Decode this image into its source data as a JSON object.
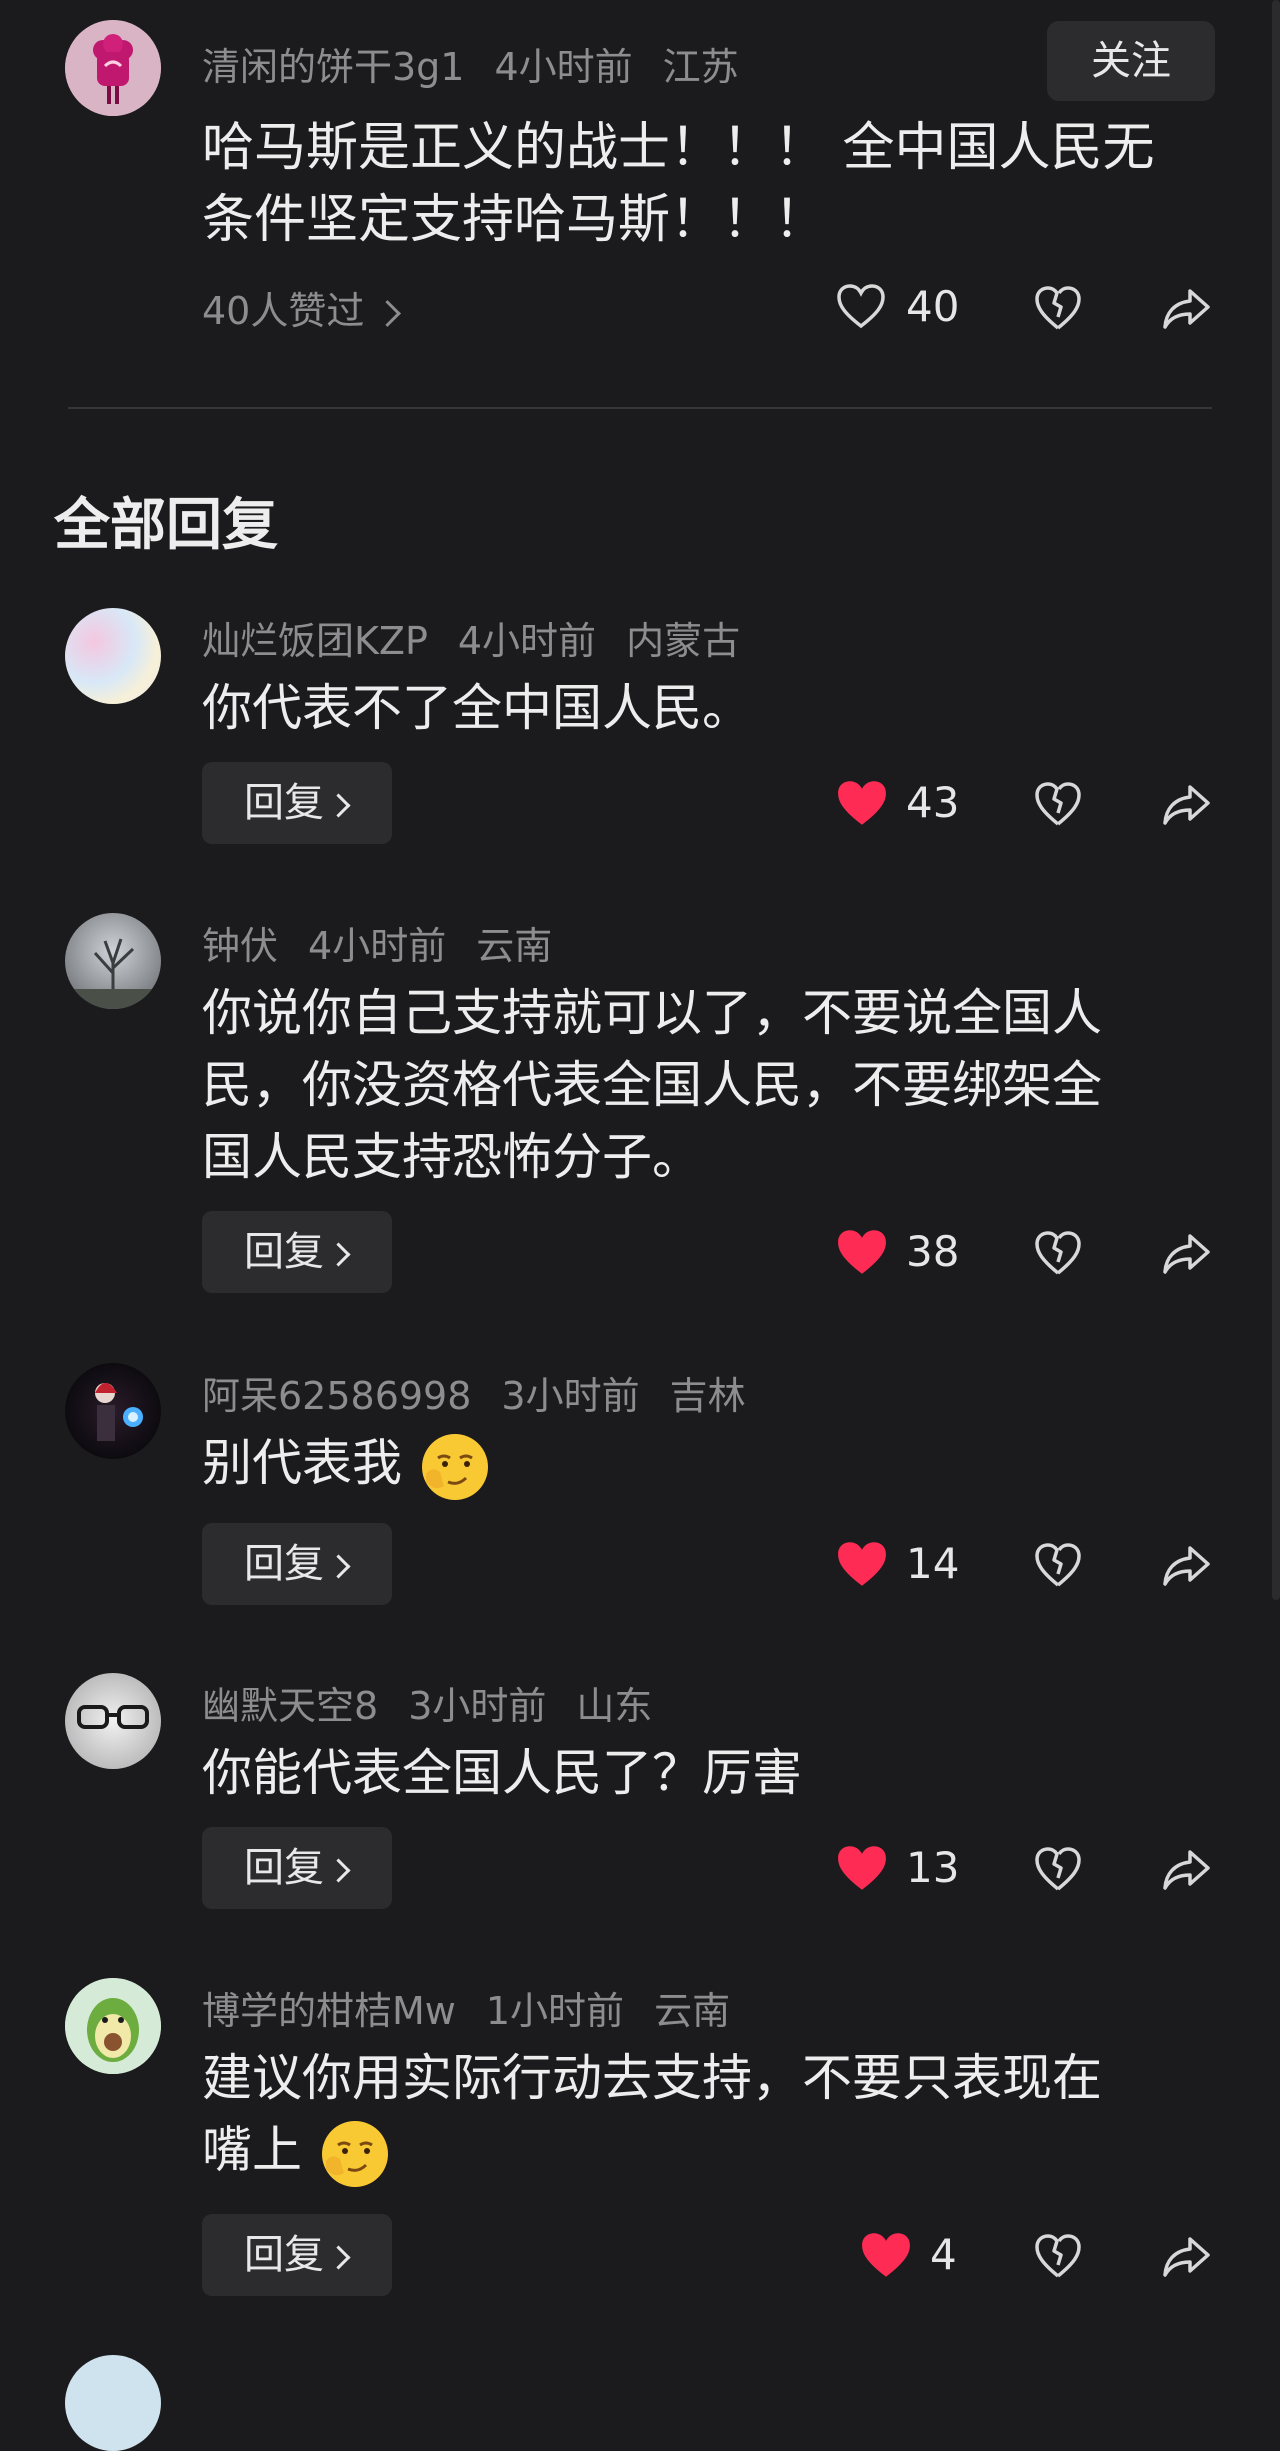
{
  "top_post": {
    "username": "清闲的饼干3g1",
    "time": "4小时前",
    "location": "江苏",
    "follow_label": "关注",
    "content_lines": [
      "哈马斯是正义的战士！！！ 全中国人民无",
      "条件坚定支持哈马斯！！！"
    ],
    "likes_link": "40人赞过",
    "like_count": "40",
    "like_icon": "heart-outline-icon",
    "dislike_icon": "broken-heart-icon",
    "share_icon": "share-icon"
  },
  "section_title": "全部回复",
  "reply_label": "回复",
  "comments": [
    {
      "username": "灿烂饭团KZP",
      "time": "4小时前",
      "location": "内蒙古",
      "lines": [
        "你代表不了全中国人民。"
      ],
      "likes": "43",
      "emoji": ""
    },
    {
      "username": "钟伏",
      "time": "4小时前",
      "location": "云南",
      "lines": [
        "你说你自己支持就可以了，不要说全国人",
        "民，你没资格代表全国人民，不要绑架全",
        "国人民支持恐怖分子。"
      ],
      "likes": "38",
      "emoji": ""
    },
    {
      "username": "阿呆62586998",
      "time": "3小时前",
      "location": "吉林",
      "lines": [
        "别代表我"
      ],
      "likes": "14",
      "emoji": "smirk-emoji"
    },
    {
      "username": "幽默天空8",
      "time": "3小时前",
      "location": "山东",
      "lines": [
        "你能代表全国人民了？厉害"
      ],
      "likes": "13",
      "emoji": ""
    },
    {
      "username": "博学的柑桔Mw",
      "time": "1小时前",
      "location": "云南",
      "lines": [
        "建议你用实际行动去支持，不要只表现在",
        "嘴上"
      ],
      "likes": "4",
      "emoji": "smirk-emoji"
    }
  ],
  "colors": {
    "background": "#1b1b1d",
    "liked_heart": "#fe2c55",
    "button_bg": "#2c2c2f",
    "meta_text": "#8d8d91"
  }
}
